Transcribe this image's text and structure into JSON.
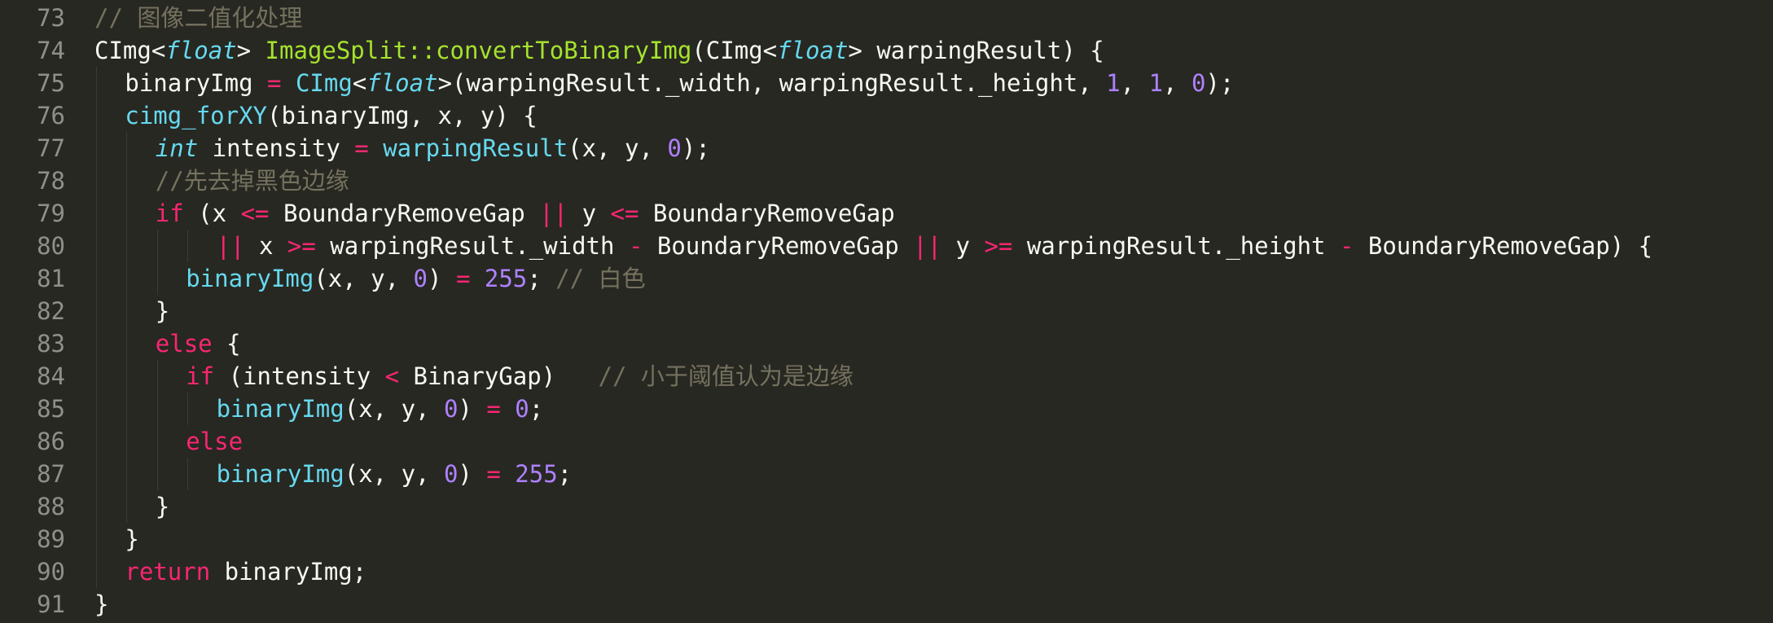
{
  "editor": {
    "lines": [
      {
        "num": "73",
        "indent": 0,
        "tokens": [
          {
            "t": "cmt",
            "v": "// 图像二值化处理"
          }
        ]
      },
      {
        "num": "74",
        "indent": 0,
        "tokens": [
          {
            "t": "pl",
            "v": "CImg<"
          },
          {
            "t": "typ",
            "v": "float"
          },
          {
            "t": "pl",
            "v": "> "
          },
          {
            "t": "fn",
            "v": "ImageSplit::convertToBinaryImg"
          },
          {
            "t": "pl",
            "v": "(CImg<"
          },
          {
            "t": "typ",
            "v": "float"
          },
          {
            "t": "pl",
            "v": "> warpingResult) {"
          }
        ]
      },
      {
        "num": "75",
        "indent": 1,
        "tokens": [
          {
            "t": "pl",
            "v": "binaryImg "
          },
          {
            "t": "op",
            "v": "="
          },
          {
            "t": "pl",
            "v": " "
          },
          {
            "t": "cls",
            "v": "CImg"
          },
          {
            "t": "pl",
            "v": "<"
          },
          {
            "t": "typ",
            "v": "float"
          },
          {
            "t": "pl",
            "v": ">(warpingResult._width, warpingResult._height, "
          },
          {
            "t": "num",
            "v": "1"
          },
          {
            "t": "pl",
            "v": ", "
          },
          {
            "t": "num",
            "v": "1"
          },
          {
            "t": "pl",
            "v": ", "
          },
          {
            "t": "num",
            "v": "0"
          },
          {
            "t": "pl",
            "v": ");"
          }
        ]
      },
      {
        "num": "76",
        "indent": 1,
        "tokens": [
          {
            "t": "cls",
            "v": "cimg_forXY"
          },
          {
            "t": "pl",
            "v": "(binaryImg, x, y) {"
          }
        ]
      },
      {
        "num": "77",
        "indent": 2,
        "tokens": [
          {
            "t": "typ",
            "v": "int"
          },
          {
            "t": "pl",
            "v": " intensity "
          },
          {
            "t": "op",
            "v": "="
          },
          {
            "t": "pl",
            "v": " "
          },
          {
            "t": "cls",
            "v": "warpingResult"
          },
          {
            "t": "pl",
            "v": "(x, y, "
          },
          {
            "t": "num",
            "v": "0"
          },
          {
            "t": "pl",
            "v": ");"
          }
        ]
      },
      {
        "num": "78",
        "indent": 2,
        "tokens": [
          {
            "t": "cmt",
            "v": "//先去掉黑色边缘"
          }
        ]
      },
      {
        "num": "79",
        "indent": 2,
        "tokens": [
          {
            "t": "kw",
            "v": "if"
          },
          {
            "t": "pl",
            "v": " (x "
          },
          {
            "t": "op",
            "v": "<="
          },
          {
            "t": "pl",
            "v": " BoundaryRemoveGap "
          },
          {
            "t": "op",
            "v": "||"
          },
          {
            "t": "pl",
            "v": " y "
          },
          {
            "t": "op",
            "v": "<="
          },
          {
            "t": "pl",
            "v": " BoundaryRemoveGap"
          }
        ]
      },
      {
        "num": "80",
        "indent": 4,
        "tokens": [
          {
            "t": "op",
            "v": "||"
          },
          {
            "t": "pl",
            "v": " x "
          },
          {
            "t": "op",
            "v": ">="
          },
          {
            "t": "pl",
            "v": " warpingResult._width "
          },
          {
            "t": "op",
            "v": "-"
          },
          {
            "t": "pl",
            "v": " BoundaryRemoveGap "
          },
          {
            "t": "op",
            "v": "||"
          },
          {
            "t": "pl",
            "v": " y "
          },
          {
            "t": "op",
            "v": ">="
          },
          {
            "t": "pl",
            "v": " warpingResult._height "
          },
          {
            "t": "op",
            "v": "-"
          },
          {
            "t": "pl",
            "v": " BoundaryRemoveGap) {"
          }
        ]
      },
      {
        "num": "81",
        "indent": 3,
        "tokens": [
          {
            "t": "cls",
            "v": "binaryImg"
          },
          {
            "t": "pl",
            "v": "(x, y, "
          },
          {
            "t": "num",
            "v": "0"
          },
          {
            "t": "pl",
            "v": ") "
          },
          {
            "t": "op",
            "v": "="
          },
          {
            "t": "pl",
            "v": " "
          },
          {
            "t": "num",
            "v": "255"
          },
          {
            "t": "pl",
            "v": "; "
          },
          {
            "t": "cmt",
            "v": "// 白色"
          }
        ]
      },
      {
        "num": "82",
        "indent": 2,
        "tokens": [
          {
            "t": "pl",
            "v": "}"
          }
        ]
      },
      {
        "num": "83",
        "indent": 2,
        "tokens": [
          {
            "t": "kw",
            "v": "else"
          },
          {
            "t": "pl",
            "v": " {"
          }
        ]
      },
      {
        "num": "84",
        "indent": 3,
        "tokens": [
          {
            "t": "kw",
            "v": "if"
          },
          {
            "t": "pl",
            "v": " (intensity "
          },
          {
            "t": "op",
            "v": "<"
          },
          {
            "t": "pl",
            "v": " BinaryGap)   "
          },
          {
            "t": "cmt",
            "v": "// 小于阈值认为是边缘"
          }
        ]
      },
      {
        "num": "85",
        "indent": 4,
        "tokens": [
          {
            "t": "cls",
            "v": "binaryImg"
          },
          {
            "t": "pl",
            "v": "(x, y, "
          },
          {
            "t": "num",
            "v": "0"
          },
          {
            "t": "pl",
            "v": ") "
          },
          {
            "t": "op",
            "v": "="
          },
          {
            "t": "pl",
            "v": " "
          },
          {
            "t": "num",
            "v": "0"
          },
          {
            "t": "pl",
            "v": ";"
          }
        ]
      },
      {
        "num": "86",
        "indent": 3,
        "tokens": [
          {
            "t": "kw",
            "v": "else"
          }
        ]
      },
      {
        "num": "87",
        "indent": 4,
        "tokens": [
          {
            "t": "cls",
            "v": "binaryImg"
          },
          {
            "t": "pl",
            "v": "(x, y, "
          },
          {
            "t": "num",
            "v": "0"
          },
          {
            "t": "pl",
            "v": ") "
          },
          {
            "t": "op",
            "v": "="
          },
          {
            "t": "pl",
            "v": " "
          },
          {
            "t": "num",
            "v": "255"
          },
          {
            "t": "pl",
            "v": ";"
          }
        ]
      },
      {
        "num": "88",
        "indent": 2,
        "tokens": [
          {
            "t": "pl",
            "v": "}"
          }
        ]
      },
      {
        "num": "89",
        "indent": 1,
        "tokens": [
          {
            "t": "pl",
            "v": "}"
          }
        ]
      },
      {
        "num": "90",
        "indent": 1,
        "tokens": [
          {
            "t": "kw",
            "v": "return"
          },
          {
            "t": "pl",
            "v": " binaryImg;"
          }
        ]
      },
      {
        "num": "91",
        "indent": 0,
        "tokens": [
          {
            "t": "pl",
            "v": "}"
          }
        ]
      }
    ]
  },
  "colors": {
    "background": "#272822",
    "line_number": "#8f908a",
    "comment": "#75715e",
    "keyword": "#f92672",
    "function": "#a6e22e",
    "type": "#66d9ef",
    "number": "#ae81ff",
    "text": "#f8f8f2"
  }
}
